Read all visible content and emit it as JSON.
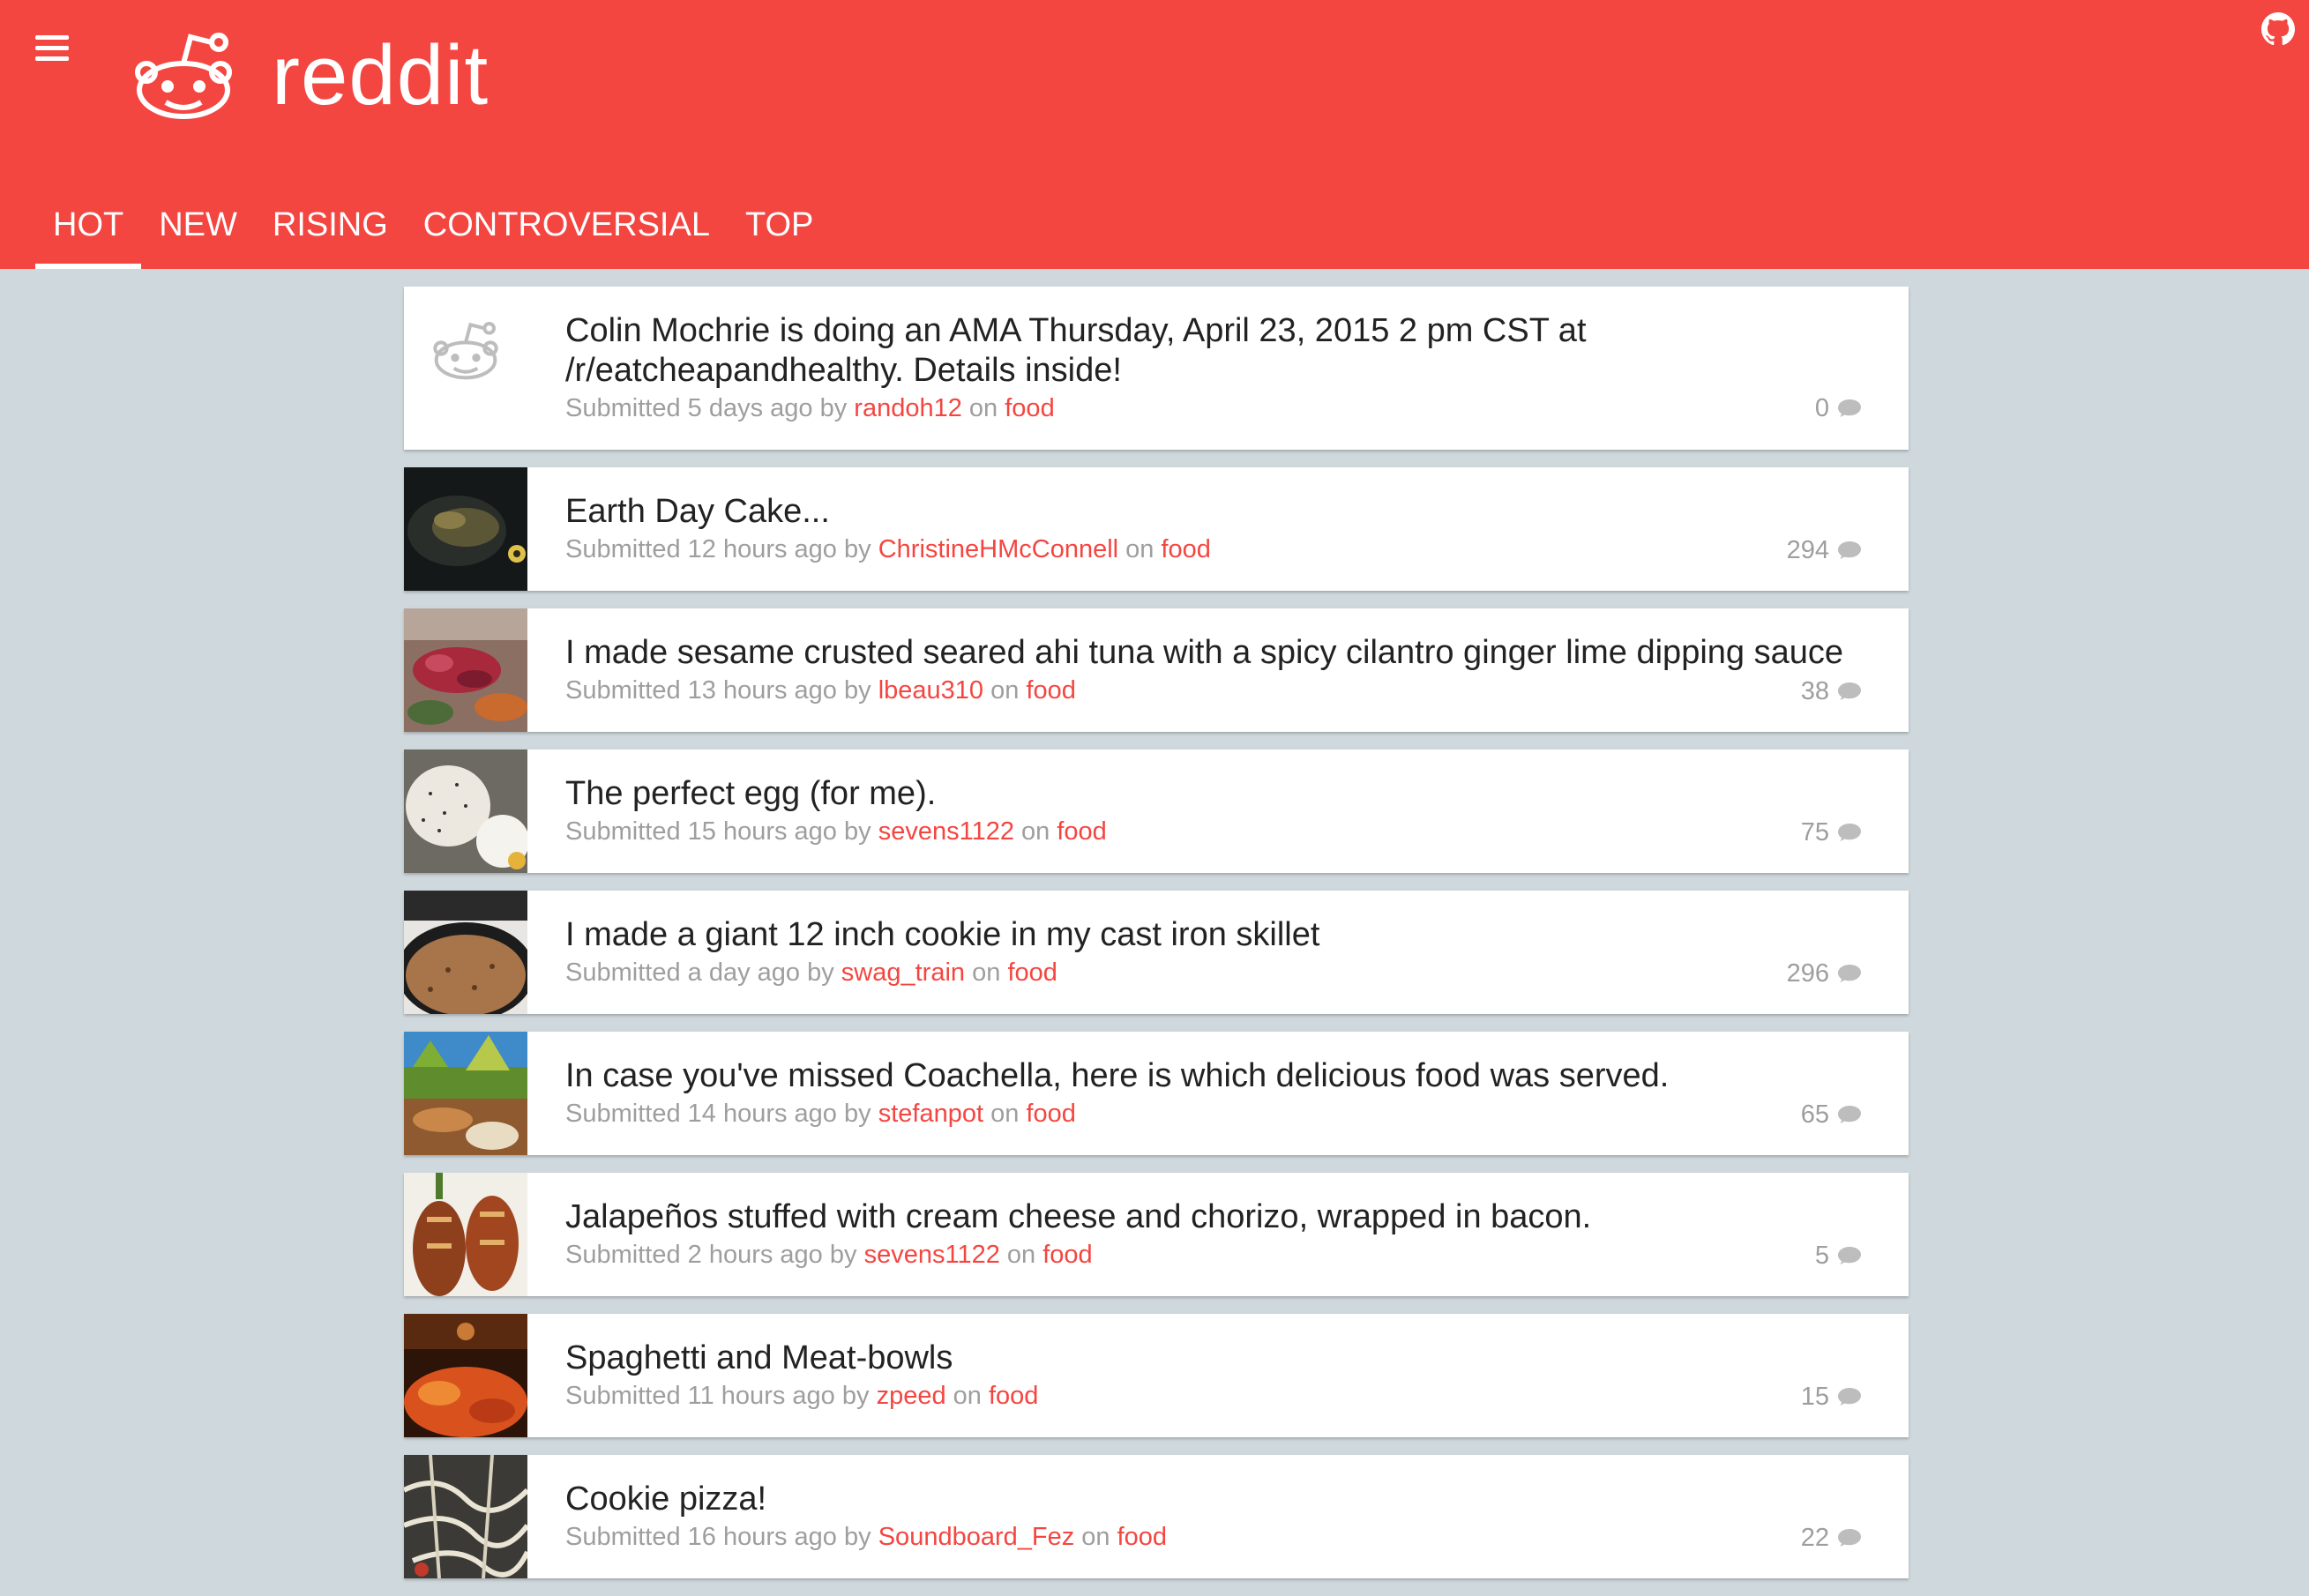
{
  "header": {
    "brand": "reddit",
    "tabs": [
      {
        "label": "HOT",
        "active": true
      },
      {
        "label": "NEW",
        "active": false
      },
      {
        "label": "RISING",
        "active": false
      },
      {
        "label": "CONTROVERSIAL",
        "active": false
      },
      {
        "label": "TOP",
        "active": false
      }
    ],
    "icons": {
      "menu": "hamburger-menu-icon",
      "logo": "reddit-alien-icon",
      "github": "github-icon"
    }
  },
  "colors": {
    "accent": "#f44641",
    "background": "#cfd8dc",
    "meta_text": "#9e9e9e",
    "title_text": "#222222"
  },
  "posts": [
    {
      "title_line1": "Colin Mochrie is doing an AMA Thursday, April 23, 2015 2 pm CST at",
      "title_line2": "/r/eatcheapandhealthy. Details inside!",
      "submitted_prefix": "Submitted",
      "time": "5 days ago",
      "by": "by",
      "author": "randoh12",
      "on": "on",
      "subreddit": "food",
      "comments": "0",
      "thumbnail": "default-reddit-icon"
    },
    {
      "title": "Earth Day Cake...",
      "submitted_prefix": "Submitted",
      "time": "12 hours ago",
      "by": "by",
      "author": "ChristineHMcConnell",
      "on": "on",
      "subreddit": "food",
      "comments": "294",
      "thumbnail": "cake-photo"
    },
    {
      "title": "I made sesame crusted seared ahi tuna with a spicy cilantro ginger lime dipping sauce",
      "submitted_prefix": "Submitted",
      "time": "13 hours ago",
      "by": "by",
      "author": "lbeau310",
      "on": "on",
      "subreddit": "food",
      "comments": "38",
      "thumbnail": "tuna-photo"
    },
    {
      "title": "The perfect egg (for me).",
      "submitted_prefix": "Submitted",
      "time": "15 hours ago",
      "by": "by",
      "author": "sevens1122",
      "on": "on",
      "subreddit": "food",
      "comments": "75",
      "thumbnail": "egg-photo"
    },
    {
      "title": "I made a giant 12 inch cookie in my cast iron skillet",
      "submitted_prefix": "Submitted",
      "time": "a day ago",
      "by": "by",
      "author": "swag_train",
      "on": "on",
      "subreddit": "food",
      "comments": "296",
      "thumbnail": "cookie-skillet-photo"
    },
    {
      "title": "In case you've missed Coachella, here is which delicious food was served.",
      "submitted_prefix": "Submitted",
      "time": "14 hours ago",
      "by": "by",
      "author": "stefanpot",
      "on": "on",
      "subreddit": "food",
      "comments": "65",
      "thumbnail": "coachella-photo"
    },
    {
      "title": "Jalapeños stuffed with cream cheese and chorizo, wrapped in bacon.",
      "submitted_prefix": "Submitted",
      "time": "2 hours ago",
      "by": "by",
      "author": "sevens1122",
      "on": "on",
      "subreddit": "food",
      "comments": "5",
      "thumbnail": "jalapeno-photo"
    },
    {
      "title": "Spaghetti and Meat-bowls",
      "submitted_prefix": "Submitted",
      "time": "11 hours ago",
      "by": "by",
      "author": "zpeed",
      "on": "on",
      "subreddit": "food",
      "comments": "15",
      "thumbnail": "spaghetti-photo"
    },
    {
      "title": "Cookie pizza!",
      "submitted_prefix": "Submitted",
      "time": "16 hours ago",
      "by": "by",
      "author": "Soundboard_Fez",
      "on": "on",
      "subreddit": "food",
      "comments": "22",
      "thumbnail": "cookie-pizza-photo"
    }
  ]
}
